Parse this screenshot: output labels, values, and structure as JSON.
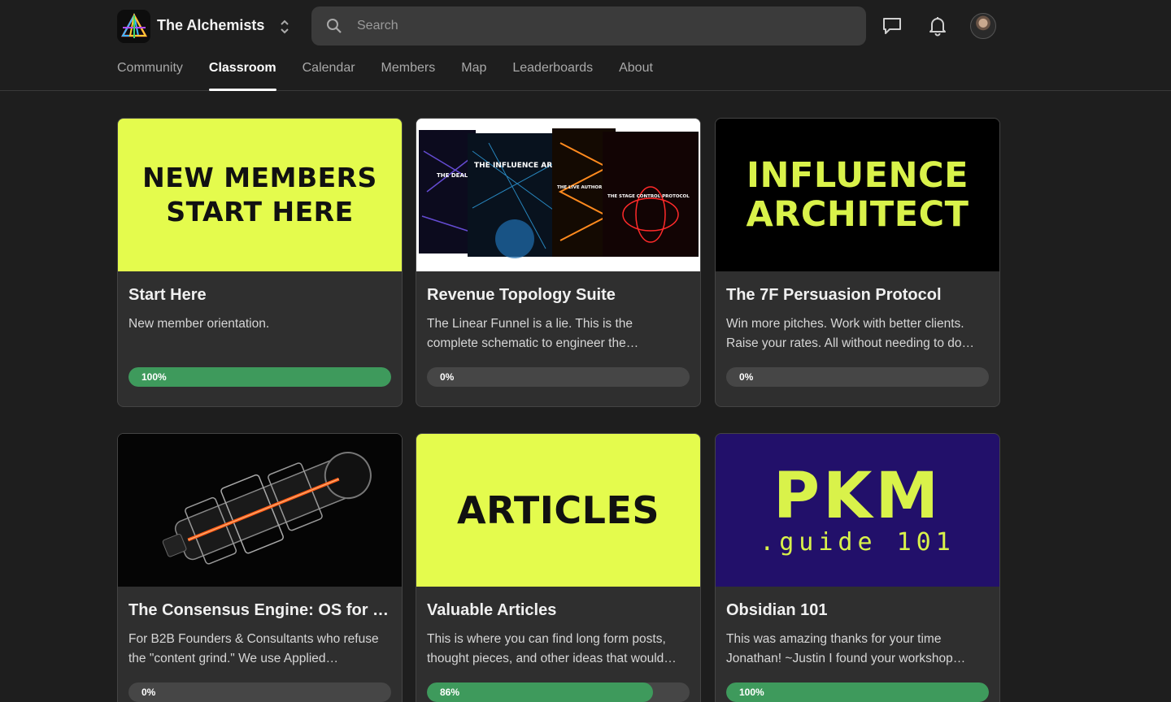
{
  "header": {
    "group_name": "The Alchemists",
    "search_placeholder": "Search",
    "colors": {
      "background": "#1e1e1e",
      "search_bg": "#3b3b3b"
    }
  },
  "tabs": [
    {
      "label": "Community",
      "active": false
    },
    {
      "label": "Classroom",
      "active": true
    },
    {
      "label": "Calendar",
      "active": false
    },
    {
      "label": "Members",
      "active": false
    },
    {
      "label": "Map",
      "active": false
    },
    {
      "label": "Leaderboards",
      "active": false
    },
    {
      "label": "About",
      "active": false
    }
  ],
  "courses": [
    {
      "title": "Start Here",
      "description": "New member orientation.",
      "progress": 100,
      "progress_label": "100%",
      "cover": {
        "style": "text",
        "lines": [
          "NEW MEMBERS",
          "START HERE"
        ],
        "bg": "#e4fb4d",
        "fg": "#111111"
      }
    },
    {
      "title": "Revenue Topology Suite",
      "description": "The Linear Funnel is a lie. This is the complete schematic to engineer the…",
      "progress": 0,
      "progress_label": "0%",
      "cover": {
        "style": "book-collage",
        "books": [
          {
            "title": "THE DEAL ARCHITECT BLUEPRINT",
            "accent": "#7b5cff"
          },
          {
            "title": "THE INFLUENCE ARCHITECT",
            "accent": "#35b6ff"
          },
          {
            "title": "THE LIVE AUTHOR",
            "accent": "#ff8a1e"
          },
          {
            "title": "THE STAGE CONTROL PROTOCOL",
            "accent": "#ff2a2a"
          }
        ]
      }
    },
    {
      "title": "The 7F Persuasion Protocol",
      "description": "Win more pitches. Work with better clients. Raise your rates. All without needing to do…",
      "progress": 0,
      "progress_label": "0%",
      "cover": {
        "style": "text",
        "lines": [
          "INFLUENCE",
          "ARCHITECT"
        ],
        "bg": "#000000",
        "fg": "#d9f24a"
      }
    },
    {
      "title": "The Consensus Engine: OS for Re…",
      "description": "For B2B Founders & Consultants who refuse the \"content grind.\" We use Applied…",
      "progress": 0,
      "progress_label": "0%",
      "cover": {
        "style": "engine",
        "bg": "#050505",
        "accent": "#ff5a14"
      }
    },
    {
      "title": "Valuable Articles",
      "description": "This is where you can find long form posts, thought pieces, and other ideas that would…",
      "progress": 86,
      "progress_label": "86%",
      "cover": {
        "style": "text",
        "lines": [
          "ARTICLES"
        ],
        "bg": "#e4fb4d",
        "fg": "#111111"
      }
    },
    {
      "title": "Obsidian 101",
      "description": "This was amazing thanks for your time Jonathan! ~Justin I found your workshop…",
      "progress": 100,
      "progress_label": "100%",
      "cover": {
        "style": "pkm",
        "lines": [
          "PKM",
          ".guide 101"
        ],
        "bg": "#22106a",
        "fg": "#d9f24a"
      }
    }
  ],
  "colors": {
    "progress_fill": "#3e9a5c",
    "progress_track": "#464646",
    "card_bg": "#2f2f2f"
  }
}
